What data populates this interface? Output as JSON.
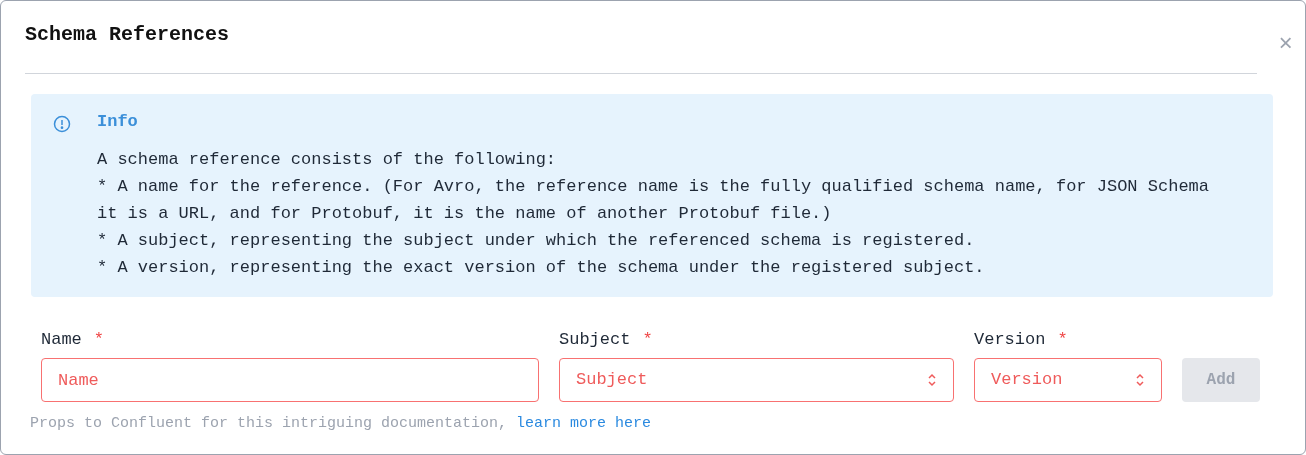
{
  "dialog": {
    "title": "Schema References",
    "close": "×"
  },
  "info": {
    "title": "Info",
    "lines": [
      "A schema reference consists of the following:",
      "* A name for the reference. (For Avro, the reference name is the fully qualified schema name, for JSON Schema it is a URL, and for Protobuf, it is the name of another Protobuf file.)",
      "* A subject, representing the subject under which the referenced schema is registered.",
      "* A version, representing the exact version of the schema under the registered subject."
    ]
  },
  "fields": [
    {
      "kind": "input",
      "label": "Name",
      "required_mark": "*",
      "invalid": true,
      "placeholder": "Name"
    },
    {
      "kind": "select",
      "label": "Subject",
      "required_mark": "*",
      "invalid": true,
      "placeholder": "Subject"
    },
    {
      "kind": "select",
      "label": "Version",
      "required_mark": "*",
      "invalid": true,
      "placeholder": "Version"
    }
  ],
  "add_button": {
    "label": "Add",
    "disabled": true
  },
  "footer": {
    "text": "Props to Confluent for this intriguing documentation,",
    "link": "learn more here"
  }
}
